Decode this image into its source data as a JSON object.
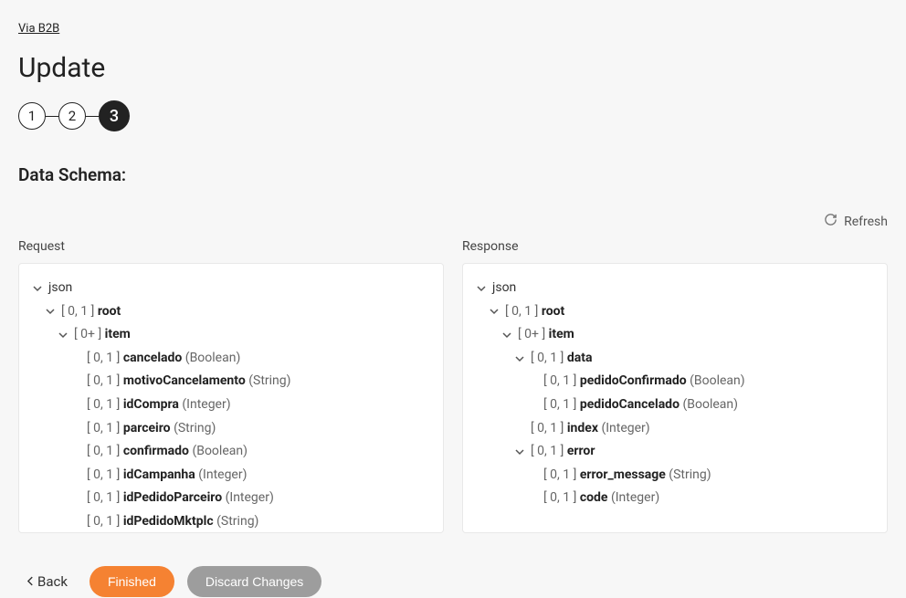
{
  "breadcrumb": "Via B2B",
  "page_title": "Update",
  "stepper": {
    "steps": [
      "1",
      "2",
      "3"
    ],
    "active_index": 2
  },
  "section_title": "Data Schema:",
  "refresh_label": "Refresh",
  "columns": {
    "request": {
      "heading": "Request",
      "tree": [
        {
          "depth": 0,
          "expandable": true,
          "label": "json"
        },
        {
          "depth": 1,
          "expandable": true,
          "cardinality": "[ 0, 1 ]",
          "name": "root"
        },
        {
          "depth": 2,
          "expandable": true,
          "cardinality": "[ 0+ ]",
          "name": "item"
        },
        {
          "depth": 3,
          "expandable": false,
          "cardinality": "[ 0, 1 ]",
          "name": "cancelado",
          "type": "(Boolean)"
        },
        {
          "depth": 3,
          "expandable": false,
          "cardinality": "[ 0, 1 ]",
          "name": "motivoCancelamento",
          "type": "(String)"
        },
        {
          "depth": 3,
          "expandable": false,
          "cardinality": "[ 0, 1 ]",
          "name": "idCompra",
          "type": "(Integer)"
        },
        {
          "depth": 3,
          "expandable": false,
          "cardinality": "[ 0, 1 ]",
          "name": "parceiro",
          "type": "(String)"
        },
        {
          "depth": 3,
          "expandable": false,
          "cardinality": "[ 0, 1 ]",
          "name": "confirmado",
          "type": "(Boolean)"
        },
        {
          "depth": 3,
          "expandable": false,
          "cardinality": "[ 0, 1 ]",
          "name": "idCampanha",
          "type": "(Integer)"
        },
        {
          "depth": 3,
          "expandable": false,
          "cardinality": "[ 0, 1 ]",
          "name": "idPedidoParceiro",
          "type": "(Integer)"
        },
        {
          "depth": 3,
          "expandable": false,
          "cardinality": "[ 0, 1 ]",
          "name": "idPedidoMktplc",
          "type": "(String)"
        }
      ]
    },
    "response": {
      "heading": "Response",
      "tree": [
        {
          "depth": 0,
          "expandable": true,
          "label": "json"
        },
        {
          "depth": 1,
          "expandable": true,
          "cardinality": "[ 0, 1 ]",
          "name": "root"
        },
        {
          "depth": 2,
          "expandable": true,
          "cardinality": "[ 0+ ]",
          "name": "item"
        },
        {
          "depth": 3,
          "expandable": true,
          "cardinality": "[ 0, 1 ]",
          "name": "data"
        },
        {
          "depth": 4,
          "expandable": false,
          "cardinality": "[ 0, 1 ]",
          "name": "pedidoConfirmado",
          "type": "(Boolean)"
        },
        {
          "depth": 4,
          "expandable": false,
          "cardinality": "[ 0, 1 ]",
          "name": "pedidoCancelado",
          "type": "(Boolean)"
        },
        {
          "depth": 3,
          "expandable": false,
          "cardinality": "[ 0, 1 ]",
          "name": "index",
          "type": "(Integer)"
        },
        {
          "depth": 3,
          "expandable": true,
          "cardinality": "[ 0, 1 ]",
          "name": "error"
        },
        {
          "depth": 4,
          "expandable": false,
          "cardinality": "[ 0, 1 ]",
          "name": "error_message",
          "type": "(String)"
        },
        {
          "depth": 4,
          "expandable": false,
          "cardinality": "[ 0, 1 ]",
          "name": "code",
          "type": "(Integer)"
        }
      ]
    }
  },
  "footer": {
    "back": "Back",
    "finished": "Finished",
    "discard": "Discard Changes"
  }
}
